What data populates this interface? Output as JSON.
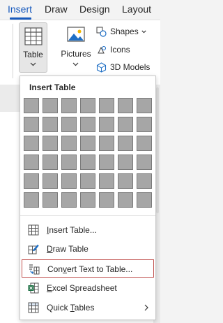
{
  "ribbon_tabs": [
    {
      "label": "Insert",
      "active": true
    },
    {
      "label": "Draw",
      "active": false
    },
    {
      "label": "Design",
      "active": false
    },
    {
      "label": "Layout",
      "active": false
    }
  ],
  "ribbon": {
    "table_label": "Table",
    "pictures_label": "Pictures",
    "shapes_label": "Shapes",
    "icons_label": "Icons",
    "models_label": "3D Models"
  },
  "dropdown": {
    "title": "Insert Table",
    "grid": {
      "rows": 6,
      "cols": 7
    },
    "items": [
      {
        "label_pre": "",
        "label_key": "I",
        "label_post": "nsert Table...",
        "icon": "insert-table-icon",
        "highlighted": false,
        "submenu": false
      },
      {
        "label_pre": "",
        "label_key": "D",
        "label_post": "raw Table",
        "icon": "draw-table-icon",
        "highlighted": false,
        "submenu": false
      },
      {
        "label_pre": "Con",
        "label_key": "v",
        "label_post": "ert Text to Table...",
        "icon": "convert-text-to-table-icon",
        "highlighted": true,
        "submenu": false
      },
      {
        "label_pre": "",
        "label_key": "E",
        "label_post": "xcel Spreadsheet",
        "icon": "excel-spreadsheet-icon",
        "highlighted": false,
        "submenu": false
      },
      {
        "label_pre": "Quick ",
        "label_key": "T",
        "label_post": "ables",
        "icon": "quick-tables-icon",
        "highlighted": false,
        "submenu": true
      }
    ]
  },
  "colors": {
    "accent": "#185abd",
    "highlight_border": "#c0504d",
    "grid_cell": "#a6a6a6",
    "excel_green": "#1e7145"
  }
}
